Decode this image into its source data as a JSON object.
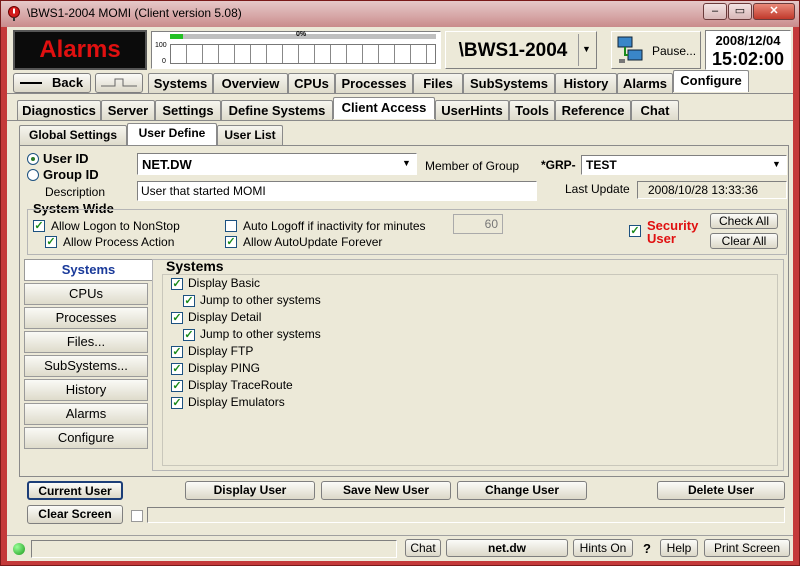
{
  "window": {
    "title": "\\BWS1-2004 MOMI (Client version 5.08)"
  },
  "header": {
    "alarms_label": "Alarms",
    "gauge_max": "100",
    "gauge_min": "0",
    "gauge_percent": "0%",
    "system_name": "\\BWS1-2004",
    "pause_label": "Pause...",
    "date": "2008/12/04",
    "time": "15:02:00"
  },
  "nav": {
    "back_label": "Back"
  },
  "main_tabs": [
    "Systems",
    "Overview",
    "CPUs",
    "Processes",
    "Files",
    "SubSystems",
    "History",
    "Alarms",
    "Configure"
  ],
  "sub_tabs": [
    "Diagnostics",
    "Server",
    "Settings",
    "Define Systems",
    "Client Access",
    "UserHints",
    "Tools",
    "Reference",
    "Chat"
  ],
  "third_tabs": [
    "Global Settings",
    "User Define",
    "User List"
  ],
  "form": {
    "user_id_label": "User ID",
    "group_id_label": "Group ID",
    "user_value": "NET.DW",
    "member_of_group_label": "Member of Group",
    "grp_prefix": "*GRP-",
    "group_value": "TEST",
    "description_label": "Description",
    "description_value": "User that started MOMI",
    "last_update_label": "Last Update",
    "last_update_value": "2008/10/28 13:33:36"
  },
  "system_wide": {
    "title": "System Wide",
    "allow_logon": "Allow Logon to NonStop",
    "allow_process": "Allow Process Action",
    "auto_logoff": "Auto Logoff if inactivity for minutes",
    "auto_logoff_minutes": "60",
    "allow_autoupdate": "Allow AutoUpdate Forever",
    "security_user_1": "Security",
    "security_user_2": "User",
    "check_all": "Check All",
    "clear_all": "Clear All"
  },
  "left_nav": [
    "Systems",
    "CPUs",
    "Processes",
    "Files...",
    "SubSystems...",
    "History",
    "Alarms",
    "Configure"
  ],
  "systems_panel": {
    "title": "Systems",
    "items": [
      {
        "label": "Display Basic",
        "indent": false
      },
      {
        "label": "Jump to other systems",
        "indent": true
      },
      {
        "label": "Display Detail",
        "indent": false
      },
      {
        "label": "Jump to other systems",
        "indent": true
      },
      {
        "label": "Display FTP",
        "indent": false
      },
      {
        "label": "Display PING",
        "indent": false
      },
      {
        "label": "Display TraceRoute",
        "indent": false
      },
      {
        "label": "Display Emulators",
        "indent": false
      }
    ]
  },
  "buttons": {
    "current_user": "Current User",
    "display_user": "Display User",
    "save_new_user": "Save New User",
    "change_user": "Change User",
    "delete_user": "Delete User",
    "clear_screen": "Clear Screen"
  },
  "statusbar": {
    "chat": "Chat",
    "user": "net.dw",
    "hints": "Hints On",
    "question": "?",
    "help": "Help",
    "print": "Print Screen"
  },
  "colors": {
    "alarm_red": "#e01010",
    "window_red": "#c43a3a",
    "face": "#ece9d8",
    "nav_active_text": "#1a3a9a"
  }
}
